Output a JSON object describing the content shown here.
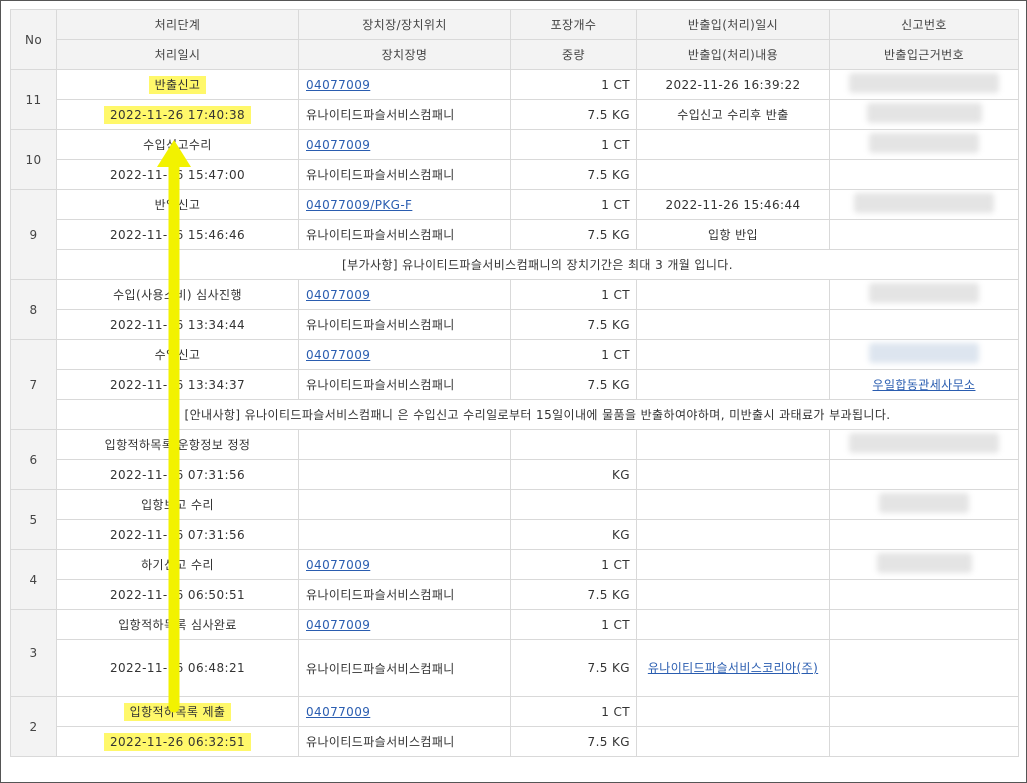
{
  "headers": {
    "no": "No",
    "row1": [
      "처리단계",
      "장치장/장치위치",
      "포장개수",
      "반출입(처리)일시",
      "신고번호"
    ],
    "row2": [
      "처리일시",
      "장치장명",
      "중량",
      "반출입(처리)내용",
      "반출입근거번호"
    ]
  },
  "rows": [
    {
      "no": "11",
      "step": "반출신고",
      "date": "2022-11-26 17:40:38",
      "loc": "04077009",
      "name": "유나이티드파슬서비스컴패니",
      "pkg": "1 CT",
      "weight": "7.5 KG",
      "io_date": "2022-11-26 16:39:22",
      "io_desc": "수입신고 수리후 반출",
      "ref": ""
    },
    {
      "no": "10",
      "step": "수입신고수리",
      "date": "2022-11-26 15:47:00",
      "loc": "04077009",
      "name": "유나이티드파슬서비스컴패니",
      "pkg": "1 CT",
      "weight": "7.5 KG",
      "io_date": "",
      "io_desc": "",
      "ref": ""
    },
    {
      "no": "9",
      "step": "반입신고",
      "date": "2022-11-26 15:46:46",
      "loc": "04077009/PKG-F",
      "name": "유나이티드파슬서비스컴패니",
      "pkg": "1 CT",
      "weight": "7.5 KG",
      "io_date": "2022-11-26 15:46:44",
      "io_desc": "입항 반입",
      "ref": "",
      "note": "[부가사항] 유나이티드파슬서비스컴패니의 장치기간은 최대 3 개월 입니다."
    },
    {
      "no": "8",
      "step": "수입(사용소비) 심사진행",
      "date": "2022-11-26 13:34:44",
      "loc": "04077009",
      "name": "유나이티드파슬서비스컴패니",
      "pkg": "1 CT",
      "weight": "7.5 KG",
      "io_date": "",
      "io_desc": "",
      "ref": ""
    },
    {
      "no": "7",
      "step": "수입신고",
      "date": "2022-11-26 13:34:37",
      "loc": "04077009",
      "name": "유나이티드파슬서비스컴패니",
      "pkg": "1 CT",
      "weight": "7.5 KG",
      "io_date": "",
      "io_desc": "",
      "ref": "우일합동관세사무소",
      "note": "[안내사항] 유나이티드파슬서비스컴패니 은 수입신고 수리일로부터 15일이내에 물품을 반출하여야하며, 미반출시 과태료가 부과됩니다."
    },
    {
      "no": "6",
      "step": "입항적하목록 운항정보 정정",
      "date": "2022-11-26 07:31:56",
      "loc": "",
      "name": "",
      "pkg": "",
      "weight": "KG",
      "io_date": "",
      "io_desc": "",
      "ref": ""
    },
    {
      "no": "5",
      "step": "입항보고 수리",
      "date": "2022-11-26 07:31:56",
      "loc": "",
      "name": "",
      "pkg": "",
      "weight": "KG",
      "io_date": "",
      "io_desc": "",
      "ref": ""
    },
    {
      "no": "4",
      "step": "하기신고 수리",
      "date": "2022-11-26 06:50:51",
      "loc": "04077009",
      "name": "유나이티드파슬서비스컴패니",
      "pkg": "1 CT",
      "weight": "7.5 KG",
      "io_date": "",
      "io_desc": "",
      "ref": ""
    },
    {
      "no": "3",
      "step": "입항적하목록 심사완료",
      "date": "2022-11-26 06:48:21",
      "loc": "04077009",
      "name": "유나이티드파슬서비스컴패니",
      "pkg": "1 CT",
      "weight": "7.5 KG",
      "io_date": "",
      "io_desc": "유나이티드파슬서비스코리아(주)",
      "ref": ""
    },
    {
      "no": "2",
      "step": "입항적하목록 제출",
      "date": "2022-11-26 06:32:51",
      "loc": "04077009",
      "name": "유나이티드파슬서비스컴패니",
      "pkg": "1 CT",
      "weight": "7.5 KG",
      "io_date": "",
      "io_desc": "",
      "ref": ""
    }
  ],
  "colors": {
    "highlight": "#fff86a",
    "arrow": "#f2f200",
    "link": "#2a5db0"
  }
}
